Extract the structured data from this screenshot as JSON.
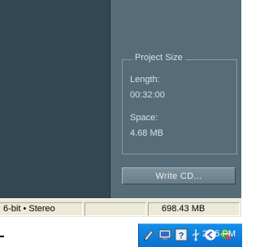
{
  "project_size": {
    "title": "Project Size",
    "length_label": "Length:",
    "length_value": "00:32:00",
    "space_label": "Space:",
    "space_value": "4.68 MB"
  },
  "buttons": {
    "write_cd": "Write CD..."
  },
  "status_bar": {
    "format": "6-bit • Stereo",
    "size": "698.43 MB"
  },
  "taskbar": {
    "clock": "2:15 PM",
    "tray_icons": [
      "pen-icon",
      "monitor-icon",
      "help-icon",
      "usb-icon",
      "back-arrow-icon",
      "network-icon"
    ]
  },
  "colors": {
    "app_background": "#4b5f6c",
    "tray_blue": "#1290e8",
    "status_bar": "#ece9d8"
  }
}
